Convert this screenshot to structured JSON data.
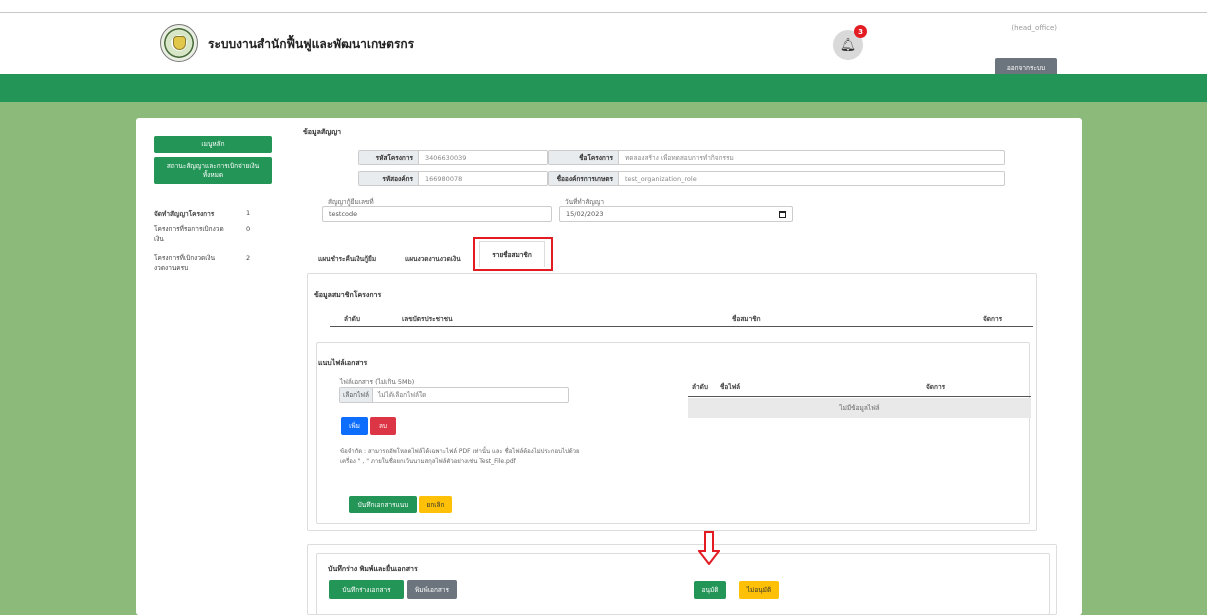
{
  "header": {
    "app_title": "ระบบงานสำนักฟื้นฟูและพัฒนาเกษตรกร",
    "notification_count": "3",
    "user_role": "(head_office)",
    "logout_label": "ออกจากระบบ"
  },
  "sidebar": {
    "main_menu_label": "เมนูหลัก",
    "contract_status_label": "สถานะสัญญาและการเบิกจ่ายเงินทั้งหมด",
    "items": [
      {
        "label": "จัดทำสัญญาโครงการ",
        "count": "1"
      },
      {
        "label": "โครงการที่รอการเบิกงวดเงิน",
        "count": "0"
      },
      {
        "label": "โครงการที่เบิกงวดเงินงวดงานครบ",
        "count": "2"
      }
    ]
  },
  "contract": {
    "section_title": "ข้อมูลสัญญา",
    "project_code_label": "รหัสโครงการ",
    "project_code": "3406630039",
    "project_name_label": "ชื่อโครงการ",
    "project_name": "ทดลองสร้าง เพื่อทดสอบการทำกิจกรรม",
    "org_code_label": "รหัสองค์กร",
    "org_code": "166980078",
    "org_name_label": "ชื่อองค์กรการเกษตร",
    "org_name": "test_organization_role",
    "loan_contract_label": "สัญญากู้ยืมเลขที่",
    "loan_contract": "testcode",
    "contract_date_label": "วันที่ทำสัญญา",
    "contract_date": "15/02/2023"
  },
  "tabs": {
    "repayment": "แผนชำระคืนเงินกู้ยืม",
    "installments": "แผนงวดงานงวดเงิน",
    "members": "รายชื่อสมาชิก"
  },
  "members": {
    "title": "ข้อมูลสมาชิกโครงการ",
    "columns": [
      "ลำดับ",
      "เลขบัตรประชาชน",
      "ชื่อสมาชิก",
      "จัดการ"
    ]
  },
  "attachments": {
    "title": "แนบไฟล์เอกสาร",
    "file_label": "ไฟล์เอกสาร (ไม่เกิน 5Mb)",
    "choose_file": "เลือกไฟล์",
    "no_file_chosen": "ไม่ได้เลือกไฟล์ใด",
    "add_label": "เพิ่ม",
    "delete_label": "ลบ",
    "note": "ข้อจำกัด : สามารถอัพโหลดไฟล์ได้เฉพาะไฟล์ PDF เท่านั้น และ ชื่อไฟล์ต้องไม่ประกอบไปด้วยเครื่อง \" , \" ภายในชื่อยกเว้นนามสกุลไฟล์ตัวอย่างเช่น Test_File.pdf",
    "save_label": "บันทึกเอกสารแนบ",
    "cancel_label": "ยกเลิก",
    "table_columns": [
      "ลำดับ",
      "ชื่อไฟล์",
      "จัดการ"
    ],
    "empty_text": "ไม่มีข้อมูลไฟล์"
  },
  "footer_actions": {
    "title": "บันทึกร่าง พิมพ์และยื่นเอกสาร",
    "save_draft": "บันทึกร่างเอกสาร",
    "print_doc": "พิมพ์เอกสาร",
    "approve": "อนุมัติ",
    "reject": "ไม่อนุมัติ"
  },
  "colors": {
    "primary_green": "#239557",
    "background_green": "#8bba7a",
    "danger": "#dc3545",
    "primary_blue": "#0d6efd",
    "warning": "#ffc107",
    "secondary": "#6c757d",
    "highlight_red": "#e31b23"
  }
}
